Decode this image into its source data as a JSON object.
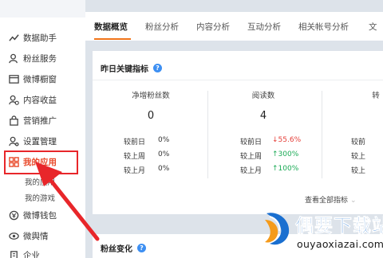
{
  "sidebar": {
    "items": [
      {
        "label": "数据助手",
        "icon": "chart-line-icon"
      },
      {
        "label": "粉丝服务",
        "icon": "user-icon"
      },
      {
        "label": "微博橱窗",
        "icon": "window-icon"
      },
      {
        "label": "内容收益",
        "icon": "user-money-icon"
      },
      {
        "label": "营销推广",
        "icon": "bag-icon"
      },
      {
        "label": "设置管理",
        "icon": "user-gear-icon"
      },
      {
        "label": "我的应用",
        "icon": "apps-grid-icon",
        "active": true
      },
      {
        "label": "微博钱包",
        "icon": "wallet-icon"
      },
      {
        "label": "微舆情",
        "icon": "eye-icon"
      },
      {
        "label": "企业",
        "icon": "building-icon"
      }
    ],
    "subitems": [
      "我的应用",
      "我的游戏"
    ]
  },
  "tabs": [
    "数据概览",
    "粉丝分析",
    "内容分析",
    "互动分析",
    "相关帐号分析",
    "文"
  ],
  "yesterday_card": {
    "title": "昨日关键指标",
    "help": "?",
    "metrics": [
      {
        "title": "净增粉丝数",
        "value": "0",
        "rows": [
          {
            "label": "较前日",
            "value": "0%"
          },
          {
            "label": "较上周",
            "value": "0%"
          },
          {
            "label": "较上月",
            "value": "0%"
          }
        ]
      },
      {
        "title": "阅读数",
        "value": "4",
        "rows": [
          {
            "label": "较前日",
            "value": "↓55.6%",
            "trend": "down"
          },
          {
            "label": "较上周",
            "value": "↑300%",
            "trend": "up"
          },
          {
            "label": "较上月",
            "value": "↑100%",
            "trend": "up"
          }
        ]
      },
      {
        "title": "转",
        "value": "",
        "rows": [
          {
            "label": "较前",
            "value": ""
          },
          {
            "label": "较上",
            "value": ""
          },
          {
            "label": "较上",
            "value": ""
          }
        ]
      }
    ],
    "view_all": "查看全部指标"
  },
  "fans_card": {
    "title": "粉丝变化",
    "help": "?"
  },
  "watermark": {
    "title": "偶要下载站",
    "url": "ouyaoxiazai.com"
  },
  "colors": {
    "accent_red": "#e94b2c",
    "tab_underline": "#f0741a",
    "help_blue": "#3d8ff2",
    "trend_down": "#e5403a",
    "trend_up": "#1aaa55",
    "annotation_red": "#e8262a",
    "watermark_blue": "#1a6fd0"
  }
}
